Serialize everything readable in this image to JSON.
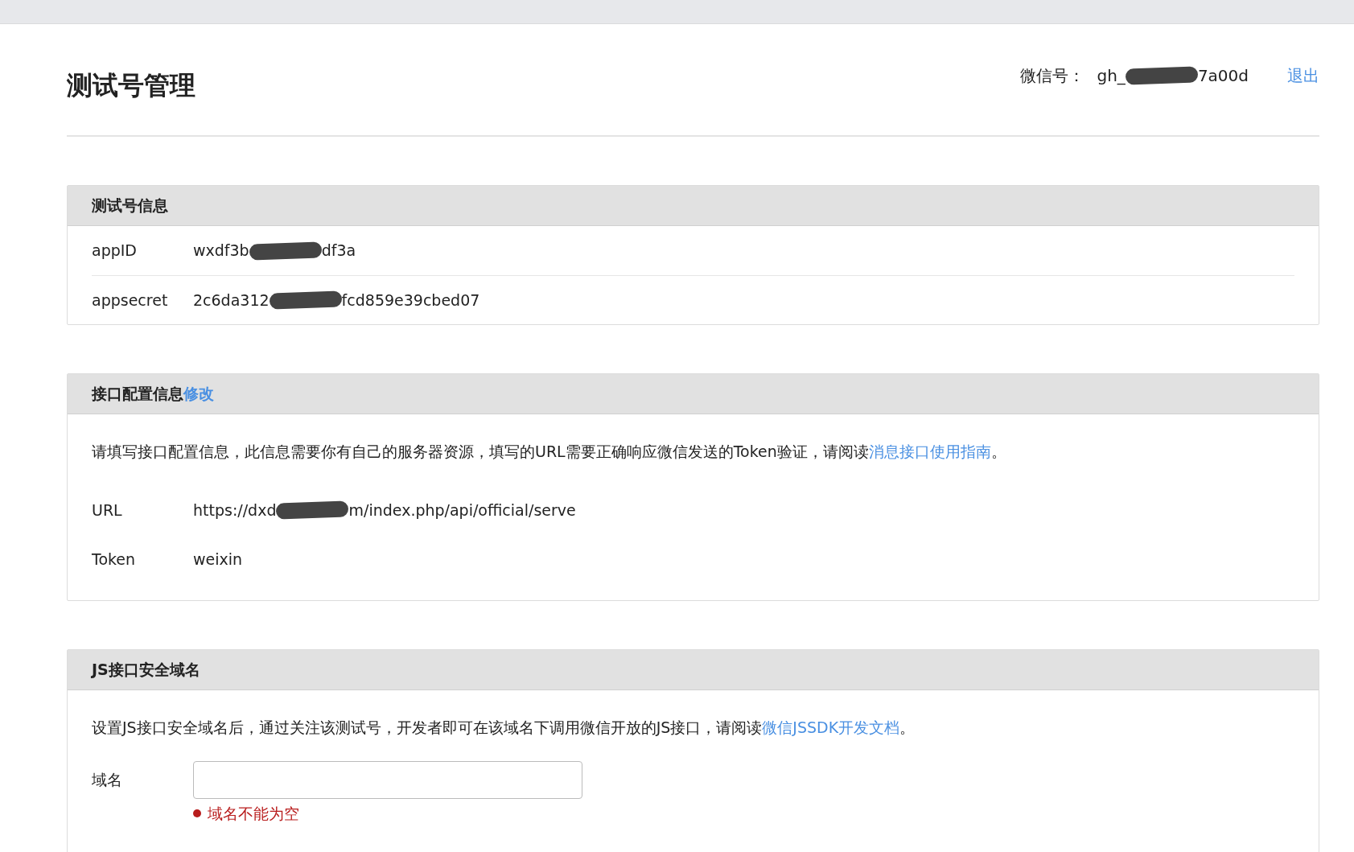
{
  "page": {
    "title": "测试号管理"
  },
  "account": {
    "label": "微信号：",
    "value_start": "gh_",
    "redacted": true,
    "value_end": "7a00d",
    "logout": "退出"
  },
  "sections": [
    {
      "kind": "fields",
      "title": "测试号信息",
      "fields": [
        {
          "label": "appID",
          "value_start": "wxdf3b",
          "redacted": true,
          "value_end": "df3a"
        },
        {
          "label": "appsecret",
          "value_start": "2c6da312",
          "redacted": true,
          "value_end": "fcd859e39cbed07"
        }
      ]
    },
    {
      "kind": "config",
      "title": "接口配置信息",
      "title_link": "修改",
      "description": "请填写接口配置信息，此信息需要你有自己的服务器资源，填写的URL需要正确响应微信发送的Token验证，请阅读",
      "description_link": "消息接口使用指南",
      "description_end": "。",
      "fields": [
        {
          "label": "URL",
          "value_start": "https://dxd",
          "redacted": true,
          "value_end": "m/index.php/api/official/serve"
        },
        {
          "label": "Token",
          "value_start": "weixin",
          "redacted": false
        }
      ]
    },
    {
      "kind": "form",
      "title": "JS接口安全域名",
      "description": "设置JS接口安全域名后，通过关注该测试号，开发者即可在该域名下调用微信开放的JS接口，请阅读",
      "description_link": "微信JSSDK开发文档",
      "description_end": "。",
      "input": {
        "label": "域名"
      },
      "error": "域名不能为空"
    }
  ]
}
